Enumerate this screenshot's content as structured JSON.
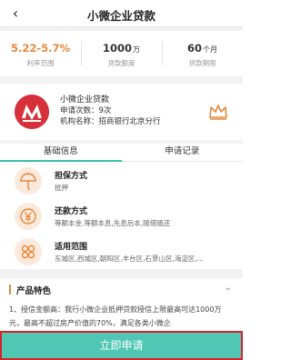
{
  "header": {
    "title": "小微企业贷款",
    "back_icon": "back-arrow-icon"
  },
  "stats": [
    {
      "value": "5.22-5.7%",
      "unit": "",
      "label": "利率范围",
      "accent": true
    },
    {
      "value": "1000",
      "unit": "万",
      "label": "贷款额度",
      "accent": false
    },
    {
      "value": "60",
      "unit": "个月",
      "label": "贷款期限",
      "accent": false
    }
  ],
  "bank": {
    "product_name": "小微企业贷款",
    "apply_count": "申请次数：9次",
    "institution": "机构名称：招商银行北京分行",
    "logo_icon": "cmb-logo-icon",
    "crown_icon": "crown-icon"
  },
  "tabs": [
    {
      "label": "基础信息",
      "active": true
    },
    {
      "label": "申请记录",
      "active": false
    }
  ],
  "info": [
    {
      "icon": "umbrella-icon",
      "title": "担保方式",
      "text": "抵押"
    },
    {
      "icon": "yuan-icon",
      "title": "还款方式",
      "text": "等额本金,等额本息,先息后本,随借随还"
    },
    {
      "icon": "grid-icon",
      "title": "适用范围",
      "text": "东城区,西城区,朝阳区,丰台区,石景山区,海淀区,..."
    }
  ],
  "features": {
    "title": "产品特色",
    "text": "1、授信金额高：我行小微企业抵押贷款授信上限最高可达1000万元，最高不超过房产价值的70%，满足各类小微企"
  },
  "apply_button": "立即申请",
  "colors": {
    "accent": "#e8893c",
    "primary": "#4fc7b2",
    "highlight_border": "#d8212b",
    "bank_red": "#d6313a"
  }
}
